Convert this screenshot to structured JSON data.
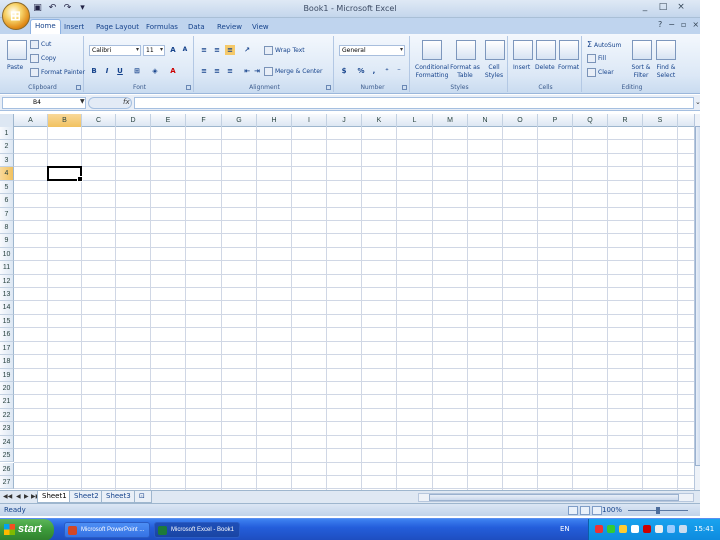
{
  "window": {
    "title": "Book1 - Microsoft Excel",
    "controls": [
      "_",
      "□",
      "×"
    ]
  },
  "qat": {
    "icons": [
      "save-icon",
      "undo-icon",
      "redo-icon",
      "customize-icon"
    ]
  },
  "tabs": [
    {
      "label": "Home",
      "active": true
    },
    {
      "label": "Insert"
    },
    {
      "label": "Page Layout"
    },
    {
      "label": "Formulas"
    },
    {
      "label": "Data"
    },
    {
      "label": "Review"
    },
    {
      "label": "View"
    }
  ],
  "ribbon": {
    "clipboard": {
      "label": "Clipboard",
      "paste": "Paste",
      "cut": "Cut",
      "copy": "Copy",
      "format_painter": "Format Painter"
    },
    "font": {
      "label": "Font",
      "name": "Calibri",
      "size": "11",
      "bold": "B",
      "italic": "I",
      "underline": "U",
      "grow": "A",
      "shrink": "A",
      "color": "A"
    },
    "alignment": {
      "label": "Alignment",
      "wrap": "Wrap Text",
      "merge": "Merge & Center"
    },
    "number": {
      "label": "Number",
      "format": "General",
      "currency": "$",
      "percent": "%",
      "comma": ","
    },
    "styles": {
      "label": "Styles",
      "conditional": "Conditional Formatting",
      "format_table": "Format as Table",
      "cell_styles": "Cell Styles"
    },
    "cells": {
      "label": "Cells",
      "insert": "Insert",
      "delete": "Delete",
      "format": "Format"
    },
    "editing": {
      "label": "Editing",
      "autosum": "AutoSum",
      "fill": "Fill",
      "clear": "Clear",
      "sort": "Sort & Filter",
      "find": "Find & Select"
    }
  },
  "formula_bar": {
    "name_box": "B4",
    "fx": "fx",
    "value": ""
  },
  "grid": {
    "columns": [
      "A",
      "B",
      "C",
      "D",
      "E",
      "F",
      "G",
      "H",
      "I",
      "J",
      "K",
      "L",
      "M",
      "N",
      "O",
      "P",
      "Q",
      "R",
      "S"
    ],
    "rows": [
      "1",
      "2",
      "3",
      "4",
      "5",
      "6",
      "7",
      "8",
      "9",
      "10",
      "11",
      "12",
      "13",
      "14",
      "15",
      "16",
      "17",
      "18",
      "19",
      "20",
      "21",
      "22",
      "23",
      "24",
      "25",
      "26",
      "27"
    ],
    "selected_column": "B",
    "selected_row": "4"
  },
  "sheets": [
    {
      "label": "Sheet1",
      "active": true
    },
    {
      "label": "Sheet2"
    },
    {
      "label": "Sheet3"
    }
  ],
  "status": {
    "text": "Ready",
    "zoom": "100%"
  },
  "taskbar": {
    "start": "start",
    "tasks": [
      "Microsoft PowerPoint ...",
      "Microsoft Excel - Book1"
    ],
    "lang": "EN",
    "clock": "15:41"
  }
}
